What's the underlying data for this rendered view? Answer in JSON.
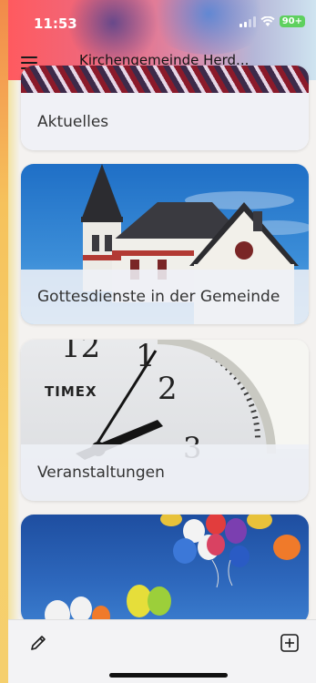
{
  "status_bar": {
    "time": "11:53",
    "battery": "90+"
  },
  "header": {
    "title": "Kirchengemeinde Herd...",
    "menu_icon": "hamburger-icon"
  },
  "cards": [
    {
      "label": "Aktuelles",
      "image": "red-abstract-photo"
    },
    {
      "label": "Gottesdienste in der Gemeinde",
      "image": "church-photo"
    },
    {
      "label": "Veranstaltungen",
      "image": "clock-photo"
    },
    {
      "label": "",
      "image": "balloons-photo"
    }
  ],
  "clock": {
    "brand": "TIMEX",
    "numbers": [
      "12",
      "1",
      "2",
      "3"
    ]
  },
  "bottom_bar": {
    "edit_icon": "pencil-icon",
    "add_icon": "plus-square-icon"
  }
}
